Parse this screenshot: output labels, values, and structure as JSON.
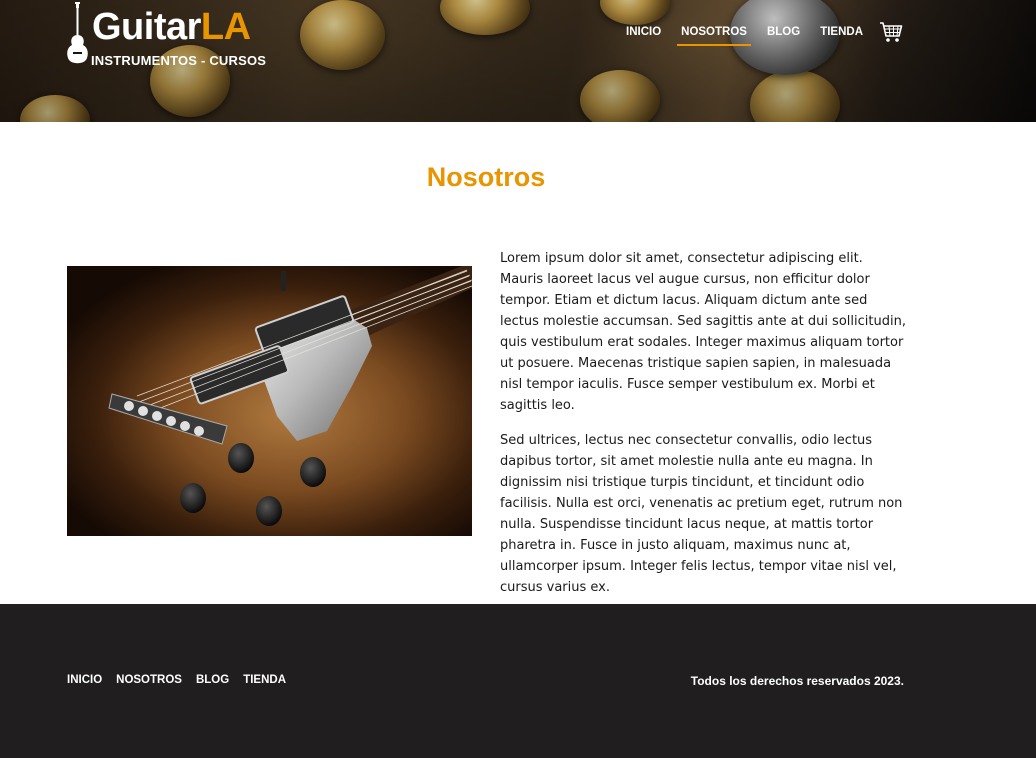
{
  "header": {
    "logo": {
      "word_main": "Guitar",
      "word_accent": "LA",
      "subtitle": "INSTRUMENTOS - CURSOS"
    },
    "nav": [
      {
        "label": "INICIO",
        "active": false
      },
      {
        "label": "NOSOTROS",
        "active": true
      },
      {
        "label": "BLOG",
        "active": false
      },
      {
        "label": "TIENDA",
        "active": false
      }
    ],
    "cart_icon": "shopping-cart-icon"
  },
  "main": {
    "title": "Nosotros",
    "paragraphs": [
      "Lorem ipsum dolor sit amet, consectetur adipiscing elit. Mauris laoreet lacus vel augue cursus, non efficitur dolor tempor. Etiam et dictum lacus. Aliquam dictum ante sed lectus molestie accumsan. Sed sagittis ante at dui sollicitudin, quis vestibulum erat sodales. Integer maximus aliquam tortor ut posuere. Maecenas tristique sapien sapien, in malesuada nisl tempor iaculis. Fusce semper vestibulum ex. Morbi et sagittis leo.",
      "Sed ultrices, lectus nec consectetur convallis, odio lectus dapibus tortor, sit amet molestie nulla ante eu magna. In dignissim nisi tristique turpis tincidunt, et tincidunt odio facilisis. Nulla est orci, venenatis ac pretium eget, rutrum non nulla. Suspendisse tincidunt lacus neque, at mattis tortor pharetra in. Fusce in justo aliquam, maximus nunc at, ullamcorper ipsum. Integer felis lectus, tempor vitae nisl vel, cursus varius ex."
    ]
  },
  "footer": {
    "nav": [
      "INICIO",
      "NOSOTROS",
      "BLOG",
      "TIENDA"
    ],
    "copyright": "Todos los derechos reservados 2023."
  },
  "colors": {
    "accent": "#e99401",
    "footer_bg": "#201e1f",
    "text": "#1a1a1a"
  }
}
